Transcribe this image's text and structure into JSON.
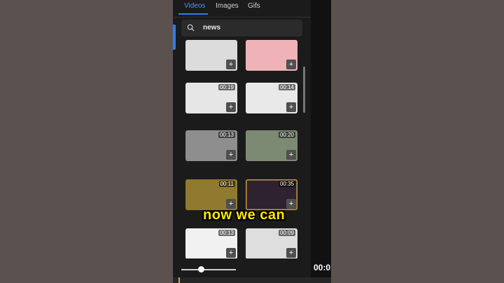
{
  "tabs": [
    "Videos",
    "Images",
    "Gifs"
  ],
  "active_tab": "Videos",
  "search": {
    "value": "news",
    "icon": "search-icon"
  },
  "thumbnails": [
    {
      "duration": "",
      "color": "#dcdcdc",
      "add_label": "+"
    },
    {
      "duration": "",
      "color": "#efb3b7",
      "add_label": "+"
    },
    {
      "duration": "00:19",
      "color": "#e6e6e6",
      "add_label": "+"
    },
    {
      "duration": "00:14",
      "color": "#e9e9e9",
      "add_label": "+"
    },
    {
      "duration": "00:13",
      "color": "#8e8e8e",
      "add_label": "+"
    },
    {
      "duration": "00:20",
      "color": "#7d8a73",
      "add_label": "+"
    },
    {
      "duration": "00:11",
      "color": "#8f7a2f",
      "add_label": "+"
    },
    {
      "duration": "00:35",
      "color": "#2e2230",
      "add_label": "+"
    },
    {
      "duration": "00:13",
      "color": "#f1f1f1",
      "add_label": "+"
    },
    {
      "duration": "00:09",
      "color": "#dedede",
      "add_label": "+"
    }
  ],
  "caption": "now we can",
  "time_readout": "00:0",
  "zoom_slider": {
    "level": 0.37
  }
}
